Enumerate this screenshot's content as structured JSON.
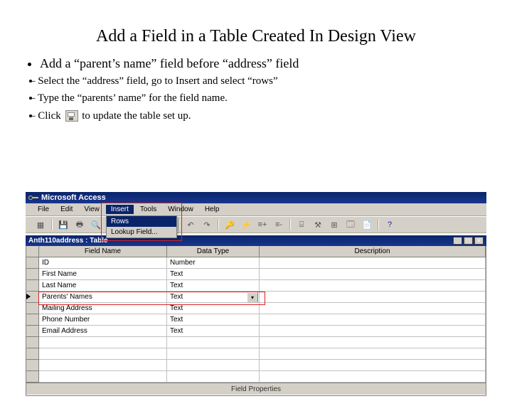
{
  "slide": {
    "title": "Add a Field in a Table Created In Design View",
    "main_bullet": "Add a “parent’s name” field before “address” field",
    "sub_bullets": [
      "Select the “address” field, go to Insert and select “rows”",
      "Type the “parents’ name” for the field name.",
      "Click",
      "to update the table set up."
    ]
  },
  "access": {
    "app_title": "Microsoft Access",
    "menus": [
      "File",
      "Edit",
      "View",
      "Insert",
      "Tools",
      "Window",
      "Help"
    ],
    "insert_dropdown": [
      "Rows",
      "Lookup Field..."
    ],
    "child_window_title": "Anth110address : Table",
    "grid": {
      "headers": [
        "Field Name",
        "Data Type",
        "Description"
      ],
      "rows": [
        {
          "field": "ID",
          "type": "Number"
        },
        {
          "field": "First Name",
          "type": "Text"
        },
        {
          "field": "Last Name",
          "type": "Text"
        },
        {
          "field": "Parents' Names",
          "type": "Text",
          "current": true
        },
        {
          "field": "Mailing Address",
          "type": "Text"
        },
        {
          "field": "Phone Number",
          "type": "Text"
        },
        {
          "field": "Email Address",
          "type": "Text"
        }
      ],
      "empty_rows": 4
    },
    "field_props_label": "Field Properties",
    "toolbar_icons": [
      "grid-icon",
      "save-icon",
      "print-icon",
      "preview-icon",
      "spell-icon",
      "cut-icon",
      "copy-icon",
      "paste-icon",
      "undo-icon",
      "redo-icon",
      "key-icon",
      "lightning-icon",
      "bolt-icon",
      "insert-rows-icon",
      "delete-rows-icon",
      "properties-icon",
      "build-icon",
      "relationships-icon",
      "db-window-icon",
      "new-object-icon",
      "help-icon"
    ]
  },
  "colors": {
    "title_blue": "#0a246a",
    "red_highlight": "#da2020",
    "chrome": "#d4d0c8"
  }
}
